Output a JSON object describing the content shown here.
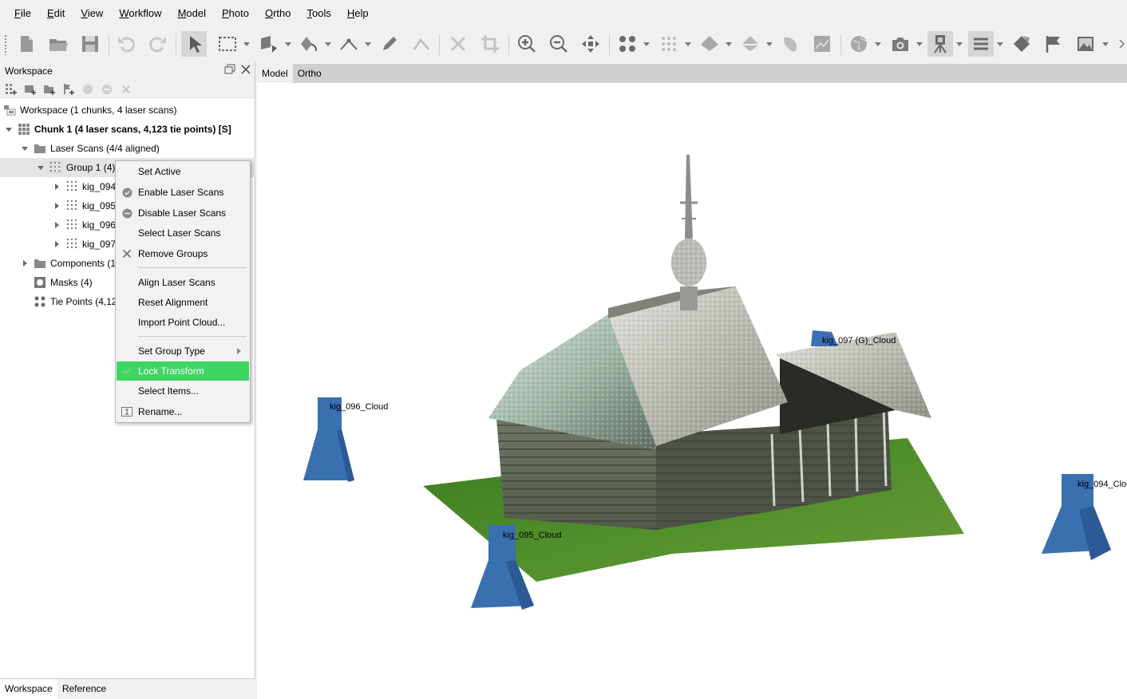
{
  "menu": [
    {
      "label": "File",
      "ul": "F",
      "rest": "ile"
    },
    {
      "label": "Edit",
      "ul": "E",
      "rest": "dit"
    },
    {
      "label": "View",
      "ul": "V",
      "rest": "iew"
    },
    {
      "label": "Workflow",
      "ul": "W",
      "rest": "orkflow"
    },
    {
      "label": "Model",
      "ul": "M",
      "rest": "odel"
    },
    {
      "label": "Photo",
      "ul": "P",
      "rest": "hoto"
    },
    {
      "label": "Ortho",
      "ul": "O",
      "rest": "rtho"
    },
    {
      "label": "Tools",
      "ul": "T",
      "rest": "ools"
    },
    {
      "label": "Help",
      "ul": "H",
      "rest": "elp"
    }
  ],
  "workspace": {
    "title": "Workspace",
    "tree": {
      "root": "Workspace (1 chunks, 4 laser scans)",
      "chunk": "Chunk 1 (4 laser scans, 4,123 tie points) [S]",
      "laser_scans": "Laser Scans (4/4 aligned)",
      "group": "Group 1 (4)",
      "scans": [
        "kig_094",
        "kig_095",
        "kig_096",
        "kig_097"
      ],
      "components": "Components (1",
      "masks": "Masks (4)",
      "tie_points": "Tie Points (4,12"
    },
    "bottom_tabs": [
      "Workspace",
      "Reference"
    ]
  },
  "view_tabs": [
    "Model",
    "Ortho"
  ],
  "context_menu": {
    "items": [
      {
        "label": "Set Active",
        "icon": ""
      },
      {
        "label": "Enable Laser Scans",
        "icon": "enable-circle-icon"
      },
      {
        "label": "Disable Laser Scans",
        "icon": "disable-circle-icon"
      },
      {
        "label": "Select Laser Scans",
        "icon": ""
      },
      {
        "label": "Remove Groups",
        "icon": "remove-x-icon"
      },
      {
        "label": "Align Laser Scans",
        "icon": ""
      },
      {
        "label": "Reset Alignment",
        "icon": ""
      },
      {
        "label": "Import Point Cloud...",
        "icon": ""
      },
      {
        "label": "Set Group Type",
        "icon": ""
      },
      {
        "label": "Lock Transform",
        "icon": "check-icon"
      },
      {
        "label": "Select Items...",
        "icon": ""
      },
      {
        "label": "Rename...",
        "icon": "rename-icon"
      }
    ],
    "highlight_color": "#3ed663"
  },
  "scene": {
    "cameras": [
      "kig_096_Cloud",
      "kig_097 (G)_Cloud",
      "kig_095_Cloud",
      "kig_094_Clou"
    ],
    "camera_color": "#3a6fb0"
  }
}
